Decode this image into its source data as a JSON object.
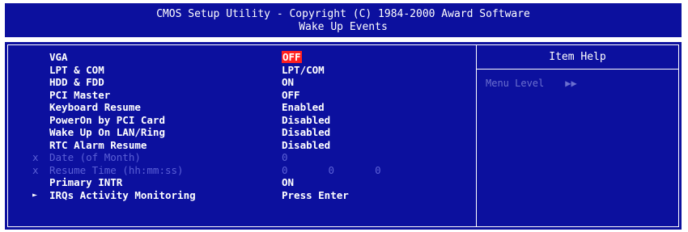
{
  "header": {
    "title": "CMOS Setup Utility - Copyright (C) 1984-2000 Award Software",
    "subtitle": "Wake Up Events"
  },
  "help": {
    "title": "Item Help",
    "menu_level_label": "Menu Level",
    "menu_level_arrows": "▶▶"
  },
  "settings": [
    {
      "label": "VGA",
      "value": "OFF"
    },
    {
      "label": "LPT & COM",
      "value": "LPT/COM"
    },
    {
      "label": "HDD & FDD",
      "value": "ON"
    },
    {
      "label": "PCI Master",
      "value": "OFF"
    },
    {
      "label": "Keyboard Resume",
      "value": "Enabled"
    },
    {
      "label": "PowerOn by PCI Card",
      "value": "Disabled"
    },
    {
      "label": "Wake Up On LAN/Ring",
      "value": "Disabled"
    },
    {
      "label": "RTC Alarm Resume",
      "value": "Disabled"
    },
    {
      "mark": "x",
      "label": "Date (of Month)",
      "value": "0"
    },
    {
      "mark": "x",
      "label": "Resume Time (hh:mm:ss)",
      "values": [
        "0",
        "0",
        "0"
      ]
    },
    {
      "label": "Primary INTR",
      "value": "ON"
    },
    {
      "mark": "►",
      "label": "IRQs Activity Monitoring",
      "value": "Press Enter"
    }
  ],
  "colors": {
    "background": "#0c109e",
    "text": "#ffffff",
    "disabled_text": "#5b60d6",
    "highlight": "#ff2020"
  }
}
